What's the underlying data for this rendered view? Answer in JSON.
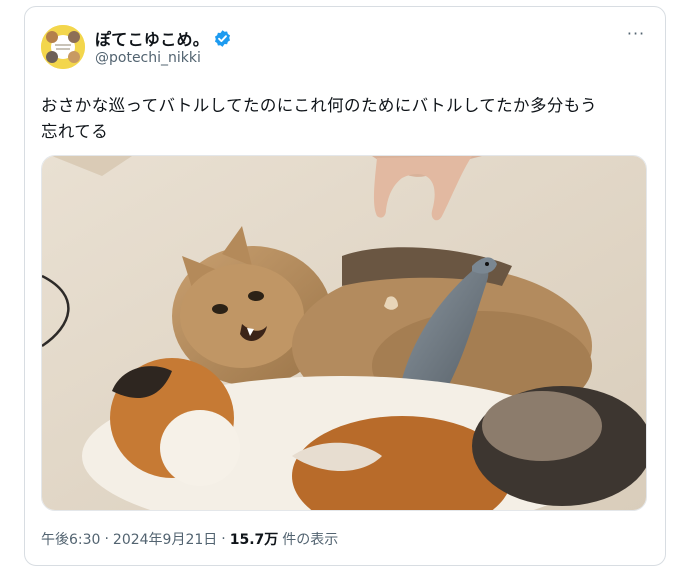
{
  "tweet": {
    "display_name": "ぽてこゆこめ。",
    "handle": "@potechi_nikki",
    "text_line1": "おさかな巡ってバトルしてたのにこれ何のためにバトルしてたか多分もう",
    "text_line2": "忘れてる",
    "time": "午後6:30",
    "separator1": "·",
    "date": "2024年9月21日",
    "separator2": "·",
    "views_count": "15.7万",
    "views_label": "件の表示",
    "more_label": "···"
  },
  "colors": {
    "verified_badge": "#1d9bf0",
    "text_primary": "#0f1419",
    "text_secondary": "#536471",
    "avatar_bg": "#f3d64c"
  },
  "icons": {
    "verified": "verified-badge-icon",
    "more": "more-options-icon"
  }
}
